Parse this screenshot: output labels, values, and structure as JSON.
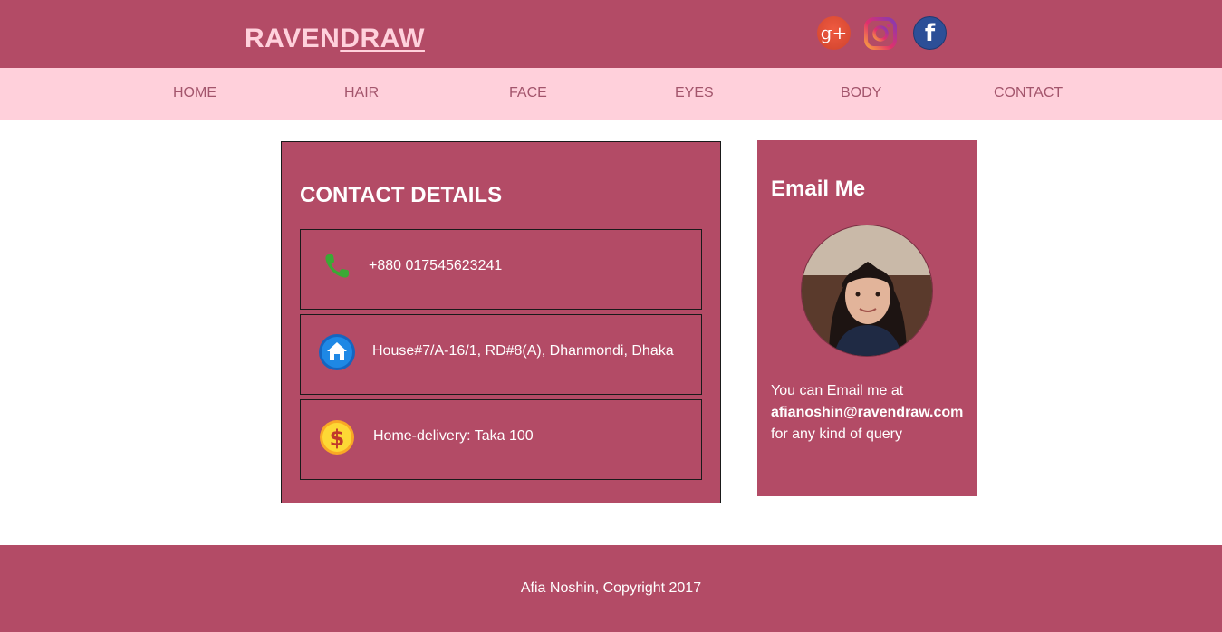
{
  "header": {
    "logo_light": "RAVEN",
    "logo_bold": "DRAW",
    "social": [
      {
        "name": "google-plus-icon",
        "glyph": "g+"
      },
      {
        "name": "instagram-icon"
      },
      {
        "name": "facebook-icon",
        "glyph": "f"
      }
    ]
  },
  "nav": {
    "items": [
      {
        "label": "HOME"
      },
      {
        "label": "HAIR"
      },
      {
        "label": "FACE"
      },
      {
        "label": "EYES"
      },
      {
        "label": "BODY"
      },
      {
        "label": "CONTACT"
      }
    ]
  },
  "contact": {
    "title": "CONTACT DETAILS",
    "rows": [
      {
        "icon": "phone-icon",
        "text": "+880 017545623241"
      },
      {
        "icon": "home-icon",
        "text": "House#7/A-16/1, RD#8(A), Dhanmondi, Dhaka"
      },
      {
        "icon": "dollar-coin-icon",
        "text": "Home-delivery: Taka 100"
      }
    ]
  },
  "email": {
    "title": "Email Me",
    "line1": "You can Email me at",
    "address": "afianoshin@ravendraw.com",
    "line3": "for any kind of query"
  },
  "footer": {
    "text": "Afia Noshin, Copyright 2017"
  },
  "colors": {
    "brand": "#b34b66",
    "nav_bg": "#ffd0db",
    "nav_text": "#a3556c",
    "logo": "#ffd1dc"
  }
}
